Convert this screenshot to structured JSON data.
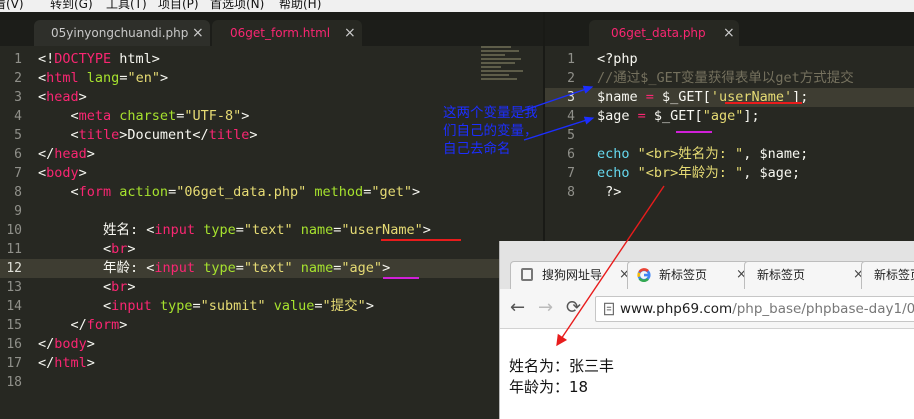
{
  "menubar": {
    "items": [
      "看(V)",
      "转到(G)",
      "工具(T)",
      "项目(P)",
      "首选项(N)",
      "帮助(H)"
    ]
  },
  "left_tabs": [
    {
      "label": "05yinyongchuandi.php",
      "active": false,
      "close": "×"
    },
    {
      "label": "06get_form.html",
      "active": true,
      "close": "×"
    }
  ],
  "right_tabs": [
    {
      "label": "06get_data.php",
      "active": true,
      "close": "×"
    }
  ],
  "left_editor": {
    "highlighted_line": 12,
    "lines": [
      {
        "n": "1",
        "tokens": [
          [
            "v",
            "<!"
          ],
          [
            "t",
            "DOCTYPE"
          ],
          [
            "v",
            " html>"
          ]
        ]
      },
      {
        "n": "2",
        "tokens": [
          [
            "v",
            "<"
          ],
          [
            "t",
            "html"
          ],
          [
            "v",
            " "
          ],
          [
            "a",
            "lang"
          ],
          [
            "v",
            "="
          ],
          [
            "s",
            "\"en\""
          ],
          [
            "v",
            ">"
          ]
        ]
      },
      {
        "n": "3",
        "tokens": [
          [
            "v",
            "<"
          ],
          [
            "t",
            "head"
          ],
          [
            "v",
            ">"
          ]
        ]
      },
      {
        "n": "4",
        "tokens": [
          [
            "v",
            "    <"
          ],
          [
            "t",
            "meta"
          ],
          [
            "v",
            " "
          ],
          [
            "a",
            "charset"
          ],
          [
            "v",
            "="
          ],
          [
            "s",
            "\"UTF-8\""
          ],
          [
            "v",
            ">"
          ]
        ]
      },
      {
        "n": "5",
        "tokens": [
          [
            "v",
            "    <"
          ],
          [
            "t",
            "title"
          ],
          [
            "v",
            ">Document</"
          ],
          [
            "t",
            "title"
          ],
          [
            "v",
            ">"
          ]
        ]
      },
      {
        "n": "6",
        "tokens": [
          [
            "v",
            "</"
          ],
          [
            "t",
            "head"
          ],
          [
            "v",
            ">"
          ]
        ]
      },
      {
        "n": "7",
        "tokens": [
          [
            "v",
            "<"
          ],
          [
            "t",
            "body"
          ],
          [
            "v",
            ">"
          ]
        ]
      },
      {
        "n": "8",
        "tokens": [
          [
            "v",
            "    <"
          ],
          [
            "t",
            "form"
          ],
          [
            "v",
            " "
          ],
          [
            "a",
            "action"
          ],
          [
            "v",
            "="
          ],
          [
            "s",
            "\"06get_data.php\""
          ],
          [
            "v",
            " "
          ],
          [
            "a",
            "method"
          ],
          [
            "v",
            "="
          ],
          [
            "s",
            "\"get\""
          ],
          [
            "v",
            ">"
          ]
        ]
      },
      {
        "n": "9",
        "tokens": []
      },
      {
        "n": "10",
        "tokens": [
          [
            "v",
            "        姓名: <"
          ],
          [
            "t",
            "input"
          ],
          [
            "v",
            " "
          ],
          [
            "a",
            "type"
          ],
          [
            "v",
            "="
          ],
          [
            "s",
            "\"text\""
          ],
          [
            "v",
            " "
          ],
          [
            "a",
            "name"
          ],
          [
            "v",
            "="
          ],
          [
            "s",
            "\"userName\""
          ],
          [
            "v",
            ">"
          ]
        ]
      },
      {
        "n": "11",
        "tokens": [
          [
            "v",
            "        <"
          ],
          [
            "t",
            "br"
          ],
          [
            "v",
            ">"
          ]
        ]
      },
      {
        "n": "12",
        "tokens": [
          [
            "v",
            "        年龄: <"
          ],
          [
            "t",
            "input"
          ],
          [
            "v",
            " "
          ],
          [
            "a",
            "type"
          ],
          [
            "v",
            "="
          ],
          [
            "s",
            "\"text\""
          ],
          [
            "v",
            " "
          ],
          [
            "a",
            "name"
          ],
          [
            "v",
            "="
          ],
          [
            "s",
            "\"age\""
          ],
          [
            "v",
            ">"
          ]
        ]
      },
      {
        "n": "13",
        "tokens": [
          [
            "v",
            "        <"
          ],
          [
            "t",
            "br"
          ],
          [
            "v",
            ">"
          ]
        ]
      },
      {
        "n": "14",
        "tokens": [
          [
            "v",
            "        <"
          ],
          [
            "t",
            "input"
          ],
          [
            "v",
            " "
          ],
          [
            "a",
            "type"
          ],
          [
            "v",
            "="
          ],
          [
            "s",
            "\"submit\""
          ],
          [
            "v",
            " "
          ],
          [
            "a",
            "value"
          ],
          [
            "v",
            "="
          ],
          [
            "s",
            "\"提交\""
          ],
          [
            "v",
            ">"
          ]
        ]
      },
      {
        "n": "15",
        "tokens": [
          [
            "v",
            "    </"
          ],
          [
            "t",
            "form"
          ],
          [
            "v",
            ">"
          ]
        ]
      },
      {
        "n": "16",
        "tokens": [
          [
            "v",
            "</"
          ],
          [
            "t",
            "body"
          ],
          [
            "v",
            ">"
          ]
        ]
      },
      {
        "n": "17",
        "tokens": [
          [
            "v",
            "</"
          ],
          [
            "t",
            "html"
          ],
          [
            "v",
            ">"
          ]
        ]
      },
      {
        "n": "18",
        "tokens": []
      }
    ]
  },
  "right_editor": {
    "highlighted_line": 3,
    "lines": [
      {
        "n": "1",
        "tokens": [
          [
            "v",
            "<?php"
          ]
        ]
      },
      {
        "n": "2",
        "tokens": [
          [
            "c",
            "//通过$_GET变量获得表单以get方式提交"
          ]
        ]
      },
      {
        "n": "3",
        "tokens": [
          [
            "v",
            "$name "
          ],
          [
            "t",
            "="
          ],
          [
            "v",
            " $_GET["
          ],
          [
            "s",
            "'userName'"
          ],
          [
            "v",
            "];"
          ]
        ]
      },
      {
        "n": "4",
        "tokens": [
          [
            "v",
            "$age "
          ],
          [
            "t",
            "="
          ],
          [
            "v",
            " $_GET["
          ],
          [
            "s",
            "\"age\""
          ],
          [
            "v",
            "];"
          ]
        ]
      },
      {
        "n": "5",
        "tokens": []
      },
      {
        "n": "6",
        "tokens": [
          [
            "k",
            "echo"
          ],
          [
            "v",
            " "
          ],
          [
            "s",
            "\"<br>姓名为: \""
          ],
          [
            "v",
            ", $name;"
          ]
        ]
      },
      {
        "n": "7",
        "tokens": [
          [
            "k",
            "echo"
          ],
          [
            "v",
            " "
          ],
          [
            "s",
            "\"<br>年龄为: \""
          ],
          [
            "v",
            ", $age;"
          ]
        ]
      },
      {
        "n": "8",
        "tokens": [
          [
            "v",
            " ?>"
          ]
        ]
      }
    ]
  },
  "annotation": {
    "text": "这两个变量是我们自己的变量，自己去命名"
  },
  "browser": {
    "tabs": [
      {
        "label": "搜狗网址导",
        "icon": "sogou-icon",
        "close": "×"
      },
      {
        "label": "新标签页",
        "icon": "google-icon",
        "close": "×"
      },
      {
        "label": "新标签页",
        "icon": "",
        "close": "×"
      },
      {
        "label": "新标签页",
        "icon": "",
        "close": "×"
      }
    ],
    "back": "←",
    "forward": "→",
    "reload": "⟳",
    "url_host": "www.php69.com",
    "url_path": "/php_base/phpbase-day1/0",
    "content_lines": [
      "姓名为：张三丰",
      "年龄为：18"
    ]
  },
  "colors": {
    "editor_bg": "#272822",
    "tag": "#f92672",
    "attr": "#a6e22e",
    "string": "#e6db74",
    "comment": "#75715e",
    "keyword": "#66d9ef",
    "annotation": "#1c2eff",
    "arrow_red": "#e81c1c"
  }
}
